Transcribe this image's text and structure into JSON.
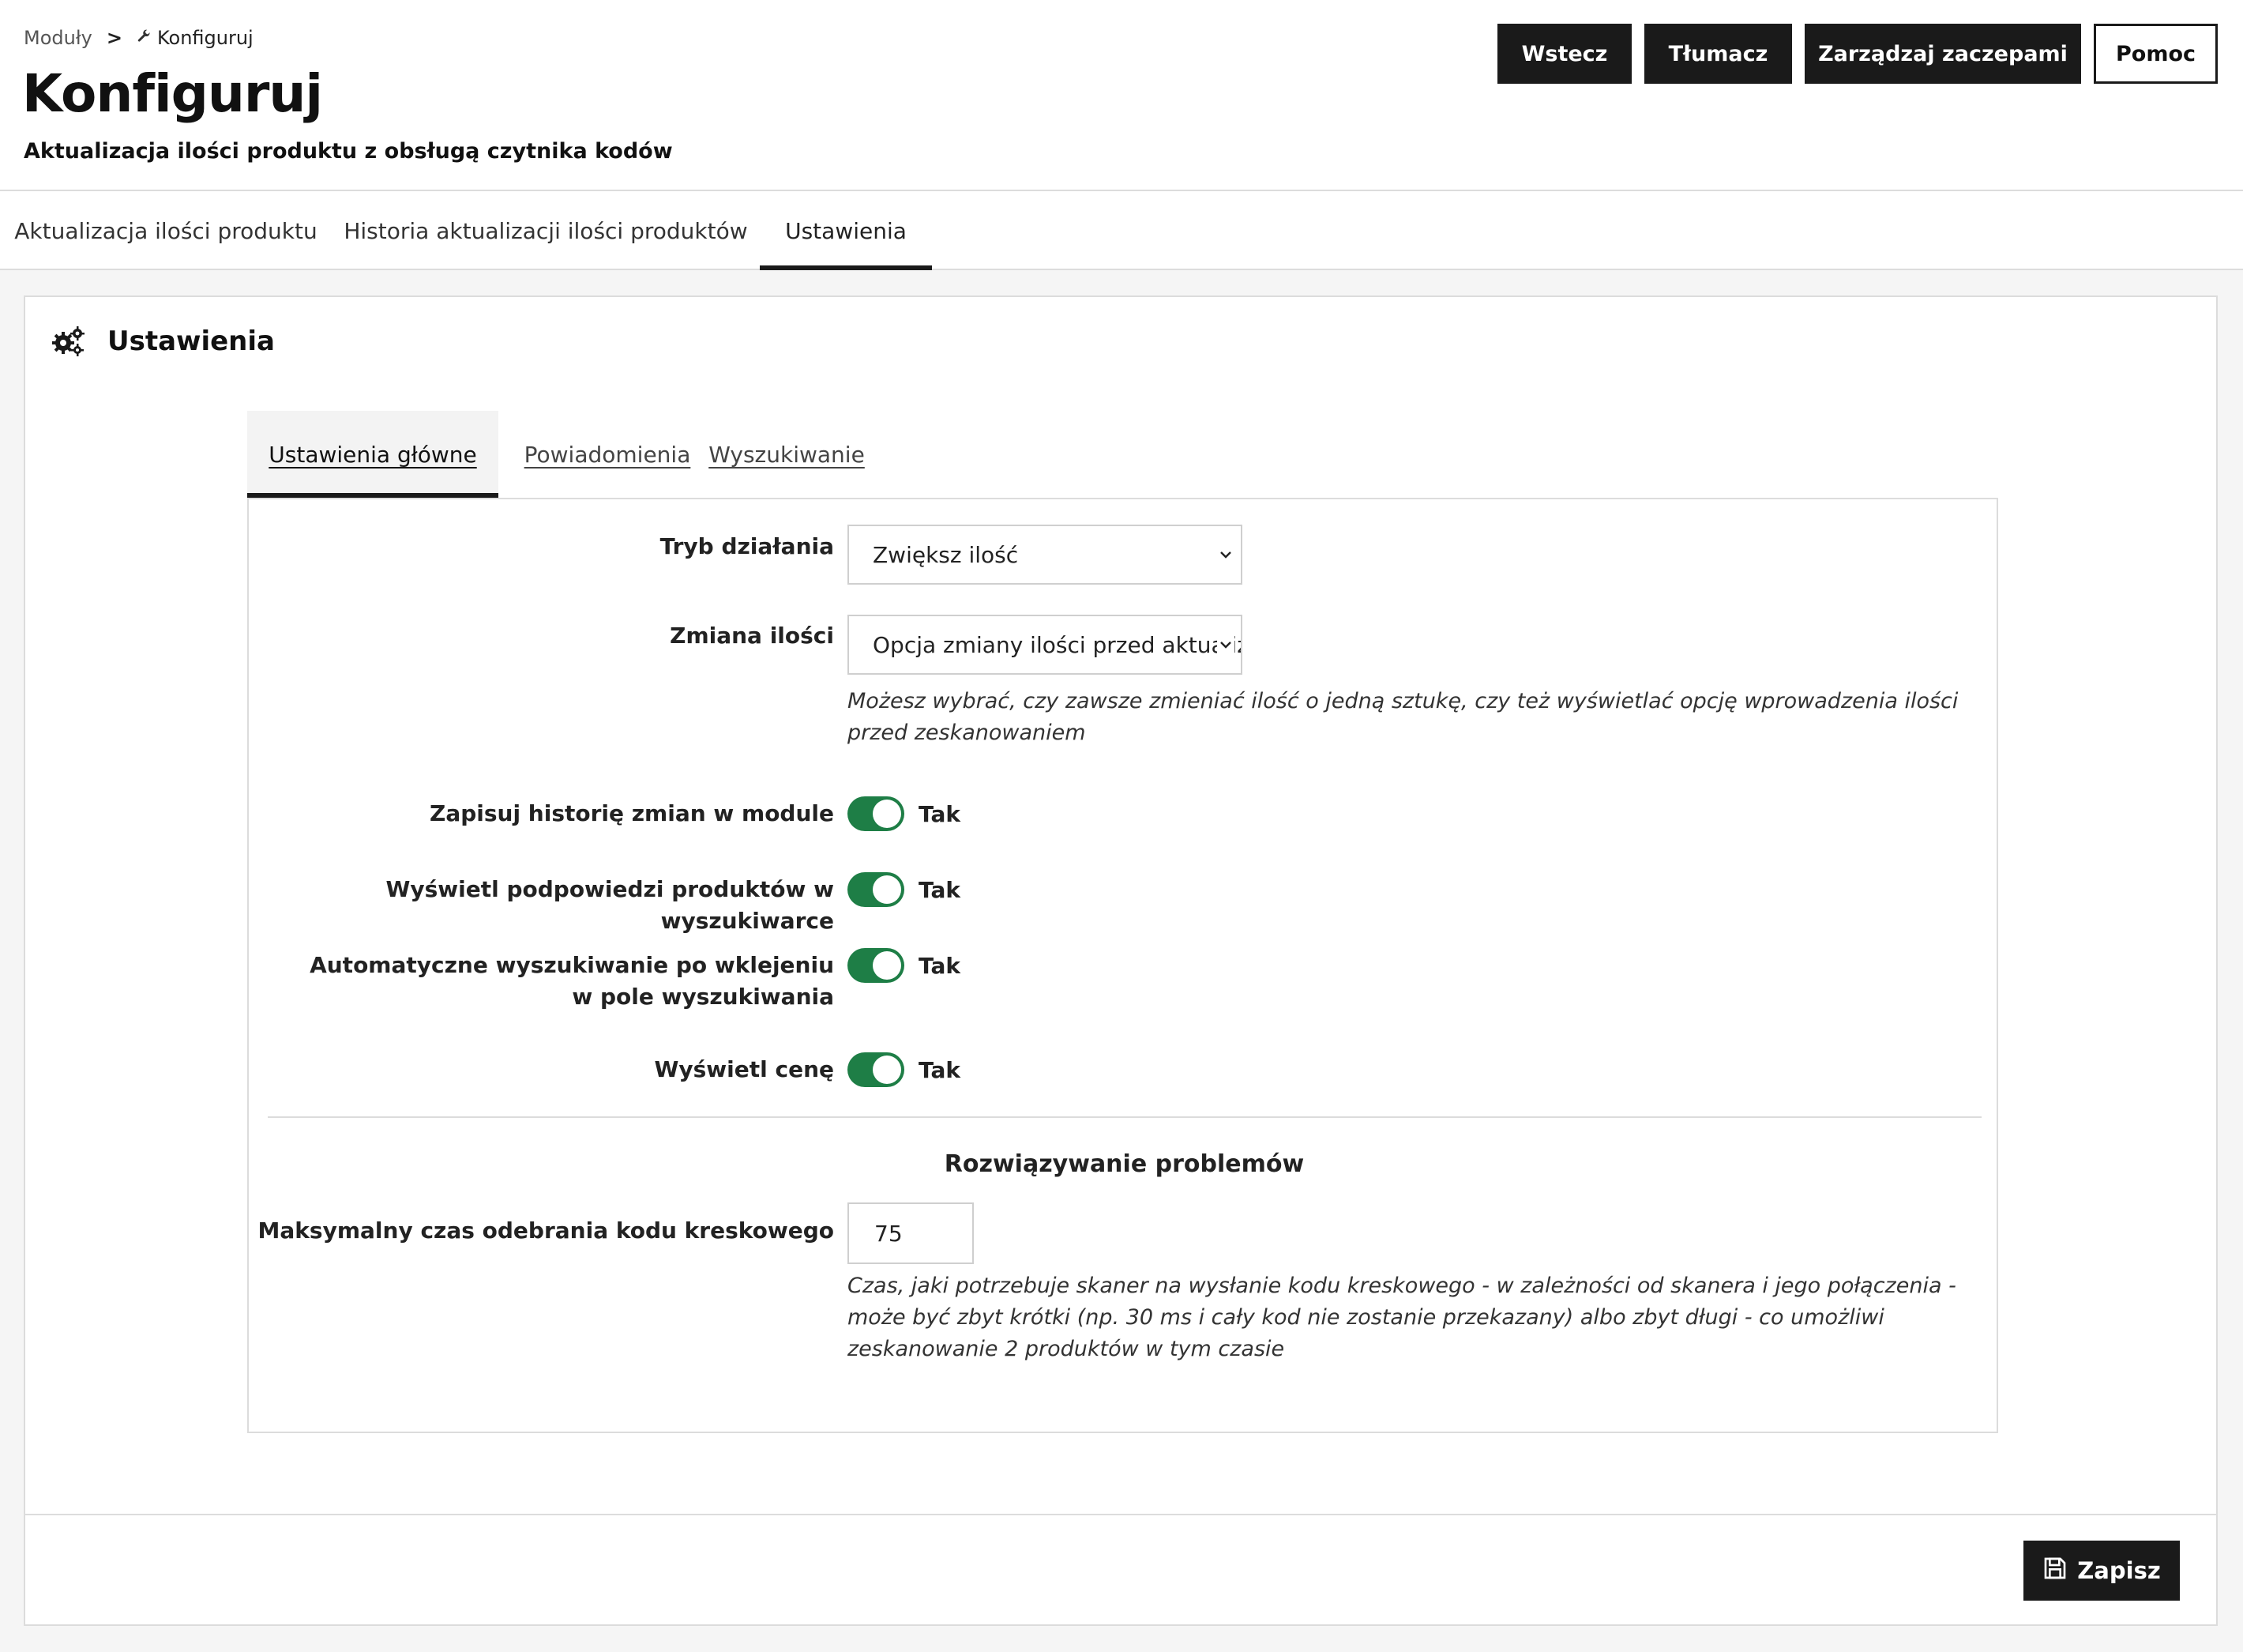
{
  "breadcrumb": {
    "parent": "Moduły",
    "separator": ">",
    "current_icon": "wrench-icon",
    "current": "Konfiguruj"
  },
  "header": {
    "title": "Konfiguruj",
    "subtitle": "Aktualizacja ilości produktu z obsługą czytnika kodów"
  },
  "toolbar": {
    "back_label": "Wstecz",
    "translate_label": "Tłumacz",
    "hooks_label": "Zarządzaj zaczepami",
    "help_label": "Pomoc"
  },
  "topnav": {
    "tabs": [
      {
        "label": "Aktualizacja ilości produktu",
        "active": false
      },
      {
        "label": "Historia aktualizacji ilości produktów",
        "active": false
      },
      {
        "label": "Ustawienia",
        "active": true
      }
    ]
  },
  "panel": {
    "icon": "gears-icon",
    "title": "Ustawienia"
  },
  "inner_tabs": [
    {
      "label": "Ustawienia główne",
      "active": true
    },
    {
      "label": "Powiadomienia",
      "active": false
    },
    {
      "label": "Wyszukiwanie",
      "active": false
    }
  ],
  "form": {
    "mode": {
      "label": "Tryb działania",
      "value": "Zwiększ ilość"
    },
    "qty_change": {
      "label": "Zmiana ilości",
      "value": "Opcja zmiany ilości przed aktualizacją",
      "help": "Możesz wybrać, czy zawsze zmieniać ilość o jedną sztukę, czy też wyświetlać opcję wprowadzenia ilości przed zeskanowaniem"
    },
    "toggles": [
      {
        "label": "Zapisuj historię zmian w module",
        "value": "Tak",
        "on": true
      },
      {
        "label": "Wyświetl podpowiedzi produktów w wyszukiwarce",
        "value": "Tak",
        "on": true
      },
      {
        "label": "Automatyczne wyszukiwanie po wklejeniu w pole wyszukiwania",
        "value": "Tak",
        "on": true
      },
      {
        "label": "Wyświetl cenę",
        "value": "Tak",
        "on": true
      }
    ],
    "troubleshooting_title": "Rozwiązywanie problemów",
    "max_time": {
      "label": "Maksymalny czas odebrania kodu kreskowego",
      "value": "75",
      "help": "Czas, jaki potrzebuje skaner na wysłanie kodu kreskowego - w zależności od skanera i jego połączenia - może być zbyt krótki (np. 30 ms i cały kod nie zostanie przekazany) albo zbyt długi - co umożliwi zeskanowanie 2 produktów w tym czasie"
    }
  },
  "footer": {
    "save_label": "Zapisz",
    "save_icon": "floppy-disk-icon"
  },
  "colors": {
    "dark": "#1a1a1a",
    "toggle_on": "#1e7e46",
    "border": "#dcdcdc"
  }
}
